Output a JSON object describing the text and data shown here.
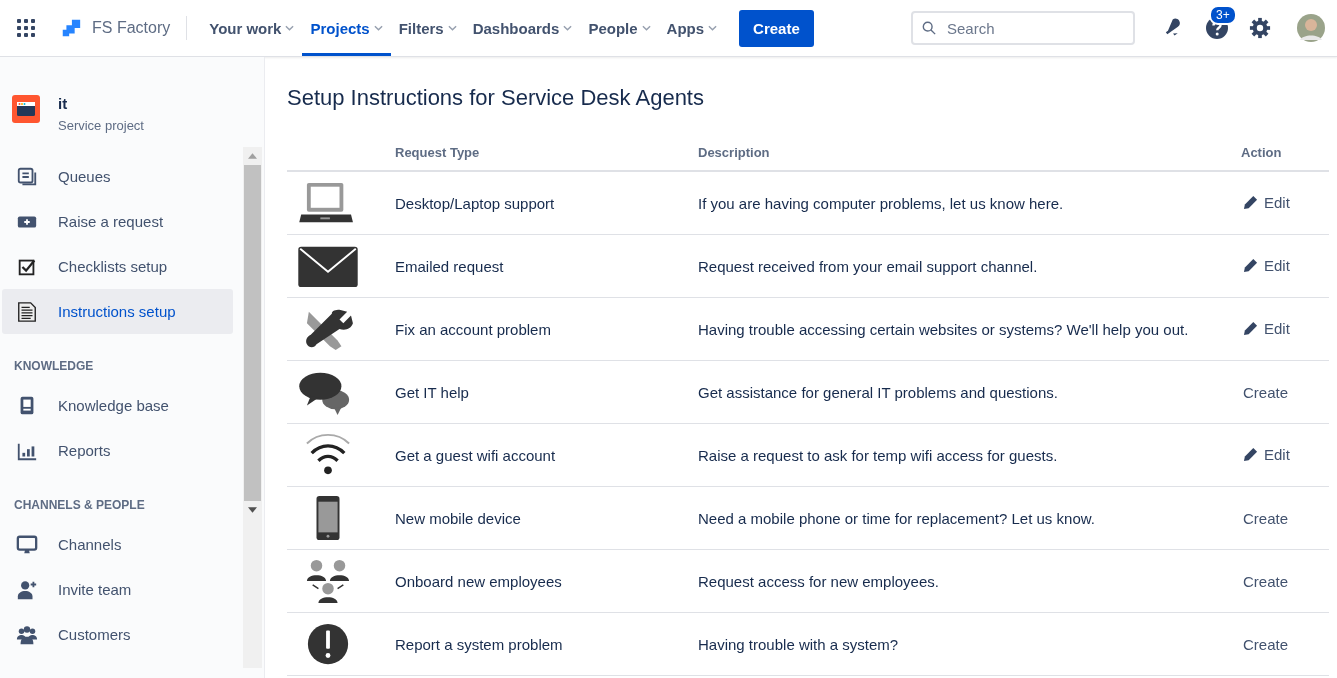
{
  "topbar": {
    "brand": "FS Factory",
    "nav": [
      {
        "label": "Your work",
        "selected": false
      },
      {
        "label": "Projects",
        "selected": true
      },
      {
        "label": "Filters",
        "selected": false
      },
      {
        "label": "Dashboards",
        "selected": false
      },
      {
        "label": "People",
        "selected": false
      },
      {
        "label": "Apps",
        "selected": false
      }
    ],
    "create": "Create",
    "search": {
      "placeholder": "Search"
    },
    "help_badge": "3+"
  },
  "sidebar": {
    "project": {
      "name": "it",
      "type": "Service project"
    },
    "sections": [
      {
        "items": [
          {
            "label": "Queues",
            "selected": false
          },
          {
            "label": "Raise a request",
            "selected": false
          },
          {
            "label": "Checklists setup",
            "selected": false
          },
          {
            "label": "Instructions setup",
            "selected": true
          }
        ]
      },
      {
        "heading": "KNOWLEDGE",
        "items": [
          {
            "label": "Knowledge base",
            "selected": false
          },
          {
            "label": "Reports",
            "selected": false
          }
        ]
      },
      {
        "heading": "CHANNELS & PEOPLE",
        "items": [
          {
            "label": "Channels",
            "selected": false
          },
          {
            "label": "Invite team",
            "selected": false
          },
          {
            "label": "Customers",
            "selected": false
          }
        ]
      }
    ]
  },
  "page": {
    "title": "Setup Instructions for Service Desk Agents",
    "table": {
      "columns": [
        "Request Type",
        "Description",
        "Action"
      ],
      "rows": [
        {
          "type": "Desktop/Laptop support",
          "description": "If you are having computer problems, let us know here.",
          "action": {
            "kind": "edit",
            "label": "Edit"
          }
        },
        {
          "type": "Emailed request",
          "description": "Request received from your email support channel.",
          "action": {
            "kind": "edit",
            "label": "Edit"
          }
        },
        {
          "type": "Fix an account problem",
          "description": "Having trouble accessing certain websites or systems? We'll help you out.",
          "action": {
            "kind": "edit",
            "label": "Edit"
          }
        },
        {
          "type": "Get IT help",
          "description": "Get assistance for general IT problems and questions.",
          "action": {
            "kind": "create",
            "label": "Create"
          }
        },
        {
          "type": "Get a guest wifi account",
          "description": "Raise a request to ask for temp wifi access for guests.",
          "action": {
            "kind": "edit",
            "label": "Edit"
          }
        },
        {
          "type": "New mobile device",
          "description": "Need a mobile phone or time for replacement? Let us know.",
          "action": {
            "kind": "create",
            "label": "Create"
          }
        },
        {
          "type": "Onboard new employees",
          "description": "Request access for new employees.",
          "action": {
            "kind": "create",
            "label": "Create"
          }
        },
        {
          "type": "Report a system problem",
          "description": "Having trouble with a system?",
          "action": {
            "kind": "create",
            "label": "Create"
          }
        }
      ]
    }
  }
}
